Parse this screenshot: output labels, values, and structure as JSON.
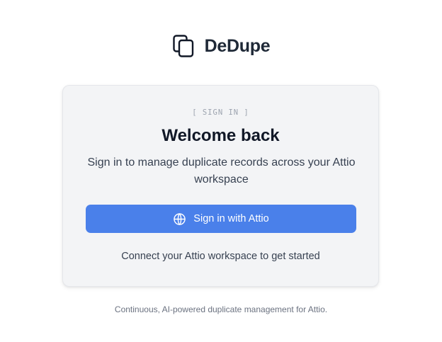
{
  "brand": {
    "name": "DeDupe",
    "icon": "copy-icon"
  },
  "card": {
    "eyebrow": "[ SIGN IN ]",
    "title": "Welcome back",
    "subtitle": "Sign in to manage duplicate records across your Attio workspace",
    "signin_button": {
      "label": "Sign in with Attio",
      "icon": "globe-icon",
      "color": "#4a80ea"
    },
    "connect_note": "Connect your Attio workspace to get started"
  },
  "footer": {
    "text": "Continuous, AI-powered duplicate management for Attio."
  }
}
